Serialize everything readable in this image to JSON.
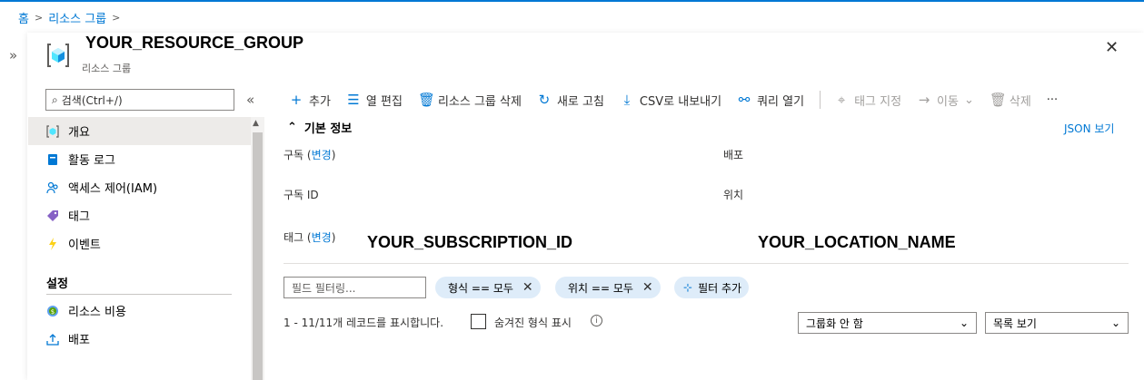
{
  "breadcrumb": [
    "홈",
    "리소스 그룹"
  ],
  "header": {
    "title": "YOUR_RESOURCE_GROUP",
    "subtitle": "리소스 그룹"
  },
  "search": {
    "placeholder": "검색(Ctrl+/)"
  },
  "sidebar": {
    "items": [
      {
        "label": "개요",
        "icon": "resource-group-icon",
        "active": true
      },
      {
        "label": "활동 로그",
        "icon": "activity-log-icon"
      },
      {
        "label": "액세스 제어(IAM)",
        "icon": "people-icon"
      },
      {
        "label": "태그",
        "icon": "tag-icon"
      },
      {
        "label": "이벤트",
        "icon": "lightning-icon"
      }
    ],
    "section": "설정",
    "settings_items": [
      {
        "label": "리소스 비용",
        "icon": "cost-icon"
      },
      {
        "label": "배포",
        "icon": "upload-icon"
      }
    ]
  },
  "toolbar": {
    "add": "추가",
    "edit_columns": "열 편집",
    "delete_group": "리소스 그룹 삭제",
    "refresh": "새로 고침",
    "export_csv": "CSV로 내보내기",
    "open_query": "쿼리 열기",
    "assign_tags": "태그 지정",
    "move": "이동",
    "delete": "삭제",
    "more": "···"
  },
  "essentials": {
    "heading": "기본 정보",
    "json_view": "JSON 보기",
    "subscription_label": "구독",
    "change_link": "변경",
    "subscription_id_label": "구독 ID",
    "tags_label": "태그",
    "deployments_label": "배포",
    "location_label": "위치",
    "subscription_id_value": "YOUR_SUBSCRIPTION_ID",
    "location_value": "YOUR_LOCATION_NAME"
  },
  "filters": {
    "field_placeholder": "필드 필터링...",
    "type_pill": "형식 == 모두",
    "location_pill": "위치 == 모두",
    "add_filter": "필터 추가"
  },
  "list": {
    "record_count": "1 - 11/11개 레코드를 표시합니다.",
    "show_hidden_types": "숨겨진 형식 표시",
    "group_by": "그룹화 안 함",
    "view": "목록 보기"
  },
  "colors": {
    "accent": "#0078d4",
    "pill_bg": "#deecf9"
  }
}
